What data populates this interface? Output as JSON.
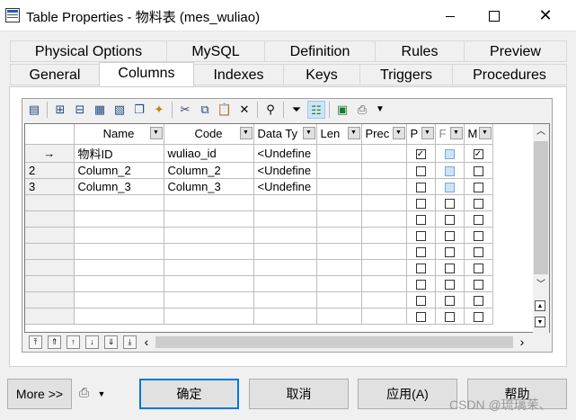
{
  "window": {
    "title": "Table Properties - 物料表 (mes_wuliao)"
  },
  "tabs": {
    "row1": [
      {
        "label": "Physical Options"
      },
      {
        "label": "MySQL"
      },
      {
        "label": "Definition"
      },
      {
        "label": "Rules"
      },
      {
        "label": "Preview"
      }
    ],
    "row2": [
      {
        "label": "General"
      },
      {
        "label": "Columns"
      },
      {
        "label": "Indexes"
      },
      {
        "label": "Keys"
      },
      {
        "label": "Triggers"
      },
      {
        "label": "Procedures"
      }
    ]
  },
  "toolbar": {
    "icons": [
      "properties-icon",
      "insert-row-icon",
      "add-row-icon",
      "add-columns-icon",
      "clone-icon",
      "new-icon",
      "cut-icon",
      "copy-icon",
      "paste-icon",
      "delete-icon",
      "find-icon",
      "filter-icon",
      "customize-columns-icon",
      "excel-icon",
      "print-icon",
      "dropdown-arrow-icon"
    ]
  },
  "grid": {
    "headers": [
      "Name",
      "Code",
      "Data Ty",
      "Len",
      "Prec",
      "P",
      "F",
      "M"
    ],
    "rows": [
      {
        "header": "→",
        "name": "物料ID",
        "code": "wuliao_id",
        "datatype": "<Undefine",
        "len": "",
        "prec": "",
        "p": true,
        "f": false,
        "m": true
      },
      {
        "header": "2",
        "name": "Column_2",
        "code": "Column_2",
        "datatype": "<Undefine",
        "len": "",
        "prec": "",
        "p": false,
        "f": false,
        "m": false
      },
      {
        "header": "3",
        "name": "Column_3",
        "code": "Column_3",
        "datatype": "<Undefine",
        "len": "",
        "prec": "",
        "p": false,
        "f": false,
        "m": false
      },
      {
        "header": "",
        "name": "",
        "code": "",
        "datatype": "",
        "len": "",
        "prec": "",
        "p": false,
        "f": false,
        "m": false
      },
      {
        "header": "",
        "name": "",
        "code": "",
        "datatype": "",
        "len": "",
        "prec": "",
        "p": false,
        "f": false,
        "m": false
      },
      {
        "header": "",
        "name": "",
        "code": "",
        "datatype": "",
        "len": "",
        "prec": "",
        "p": false,
        "f": false,
        "m": false
      },
      {
        "header": "",
        "name": "",
        "code": "",
        "datatype": "",
        "len": "",
        "prec": "",
        "p": false,
        "f": false,
        "m": false
      },
      {
        "header": "",
        "name": "",
        "code": "",
        "datatype": "",
        "len": "",
        "prec": "",
        "p": false,
        "f": false,
        "m": false
      },
      {
        "header": "",
        "name": "",
        "code": "",
        "datatype": "",
        "len": "",
        "prec": "",
        "p": false,
        "f": false,
        "m": false
      },
      {
        "header": "",
        "name": "",
        "code": "",
        "datatype": "",
        "len": "",
        "prec": "",
        "p": false,
        "f": false,
        "m": false
      },
      {
        "header": "",
        "name": "",
        "code": "",
        "datatype": "",
        "len": "",
        "prec": "",
        "p": false,
        "f": false,
        "m": false
      }
    ]
  },
  "footer": {
    "more": "More >>",
    "ok": "确定",
    "cancel": "取消",
    "apply": "应用(A)",
    "help": "帮助"
  },
  "watermark": "CSDN @琉璃茉、"
}
